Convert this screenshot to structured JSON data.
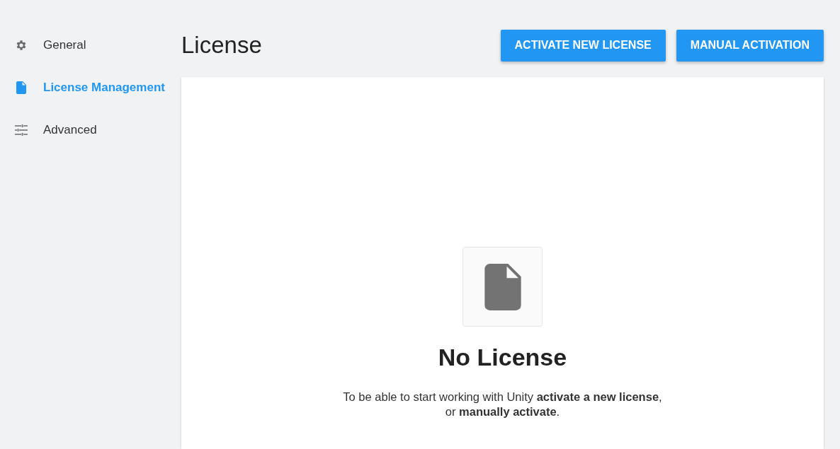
{
  "sidebar": {
    "items": [
      {
        "label": "General",
        "kind": "gear",
        "selected": false
      },
      {
        "label": "License Management",
        "kind": "file",
        "selected": true
      },
      {
        "label": "Advanced",
        "kind": "sliders",
        "selected": false
      }
    ]
  },
  "header": {
    "title": "License",
    "buttons": [
      "ACTIVATE NEW LICENSE",
      "MANUAL ACTIVATION"
    ]
  },
  "empty_state": {
    "title": "No License",
    "message": "To be able to start working with Unity **activate a new license**,\nor **manually activate**."
  }
}
